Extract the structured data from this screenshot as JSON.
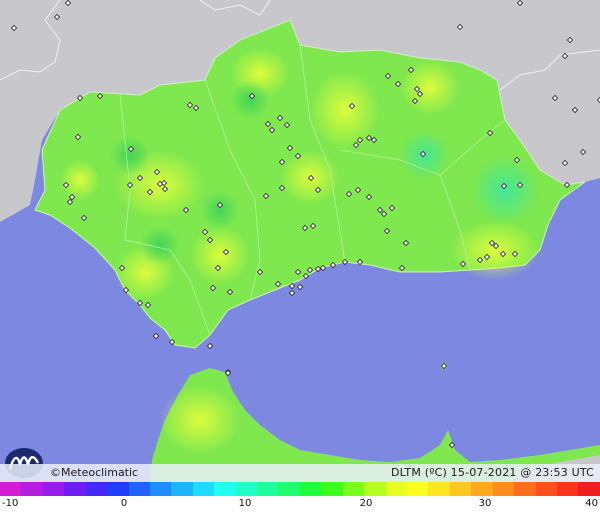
{
  "credit": "©Meteoclimatic",
  "product": "DLTM (ºC)  15-07-2021 @ 23:53 UTC",
  "legend": {
    "ticks": [
      "-10",
      "0",
      "10",
      "20",
      "30",
      "40"
    ],
    "colors": [
      "#d21ed2",
      "#b41ee1",
      "#961eeb",
      "#6e1ef0",
      "#4628f5",
      "#1e3cff",
      "#1e64ff",
      "#1e8cff",
      "#1eb4ff",
      "#1edcff",
      "#1efff0",
      "#1effc8",
      "#1eff9b",
      "#1eff6e",
      "#1eff3c",
      "#3cff1e",
      "#78ff1e",
      "#b4ff1e",
      "#e6ff1e",
      "#ffff1e",
      "#ffe61e",
      "#ffc81e",
      "#ffaa1e",
      "#ff8c1e",
      "#ff6e1e",
      "#ff501e",
      "#ff321e",
      "#f01e1e"
    ]
  },
  "colors": {
    "sea": "#7d88e0",
    "land_outside": "#c8c8cc",
    "region_base": "#7fe84e"
  },
  "icons": {
    "logo": "meteoclimatic-wave-logo",
    "station": "station-diamond-marker"
  }
}
